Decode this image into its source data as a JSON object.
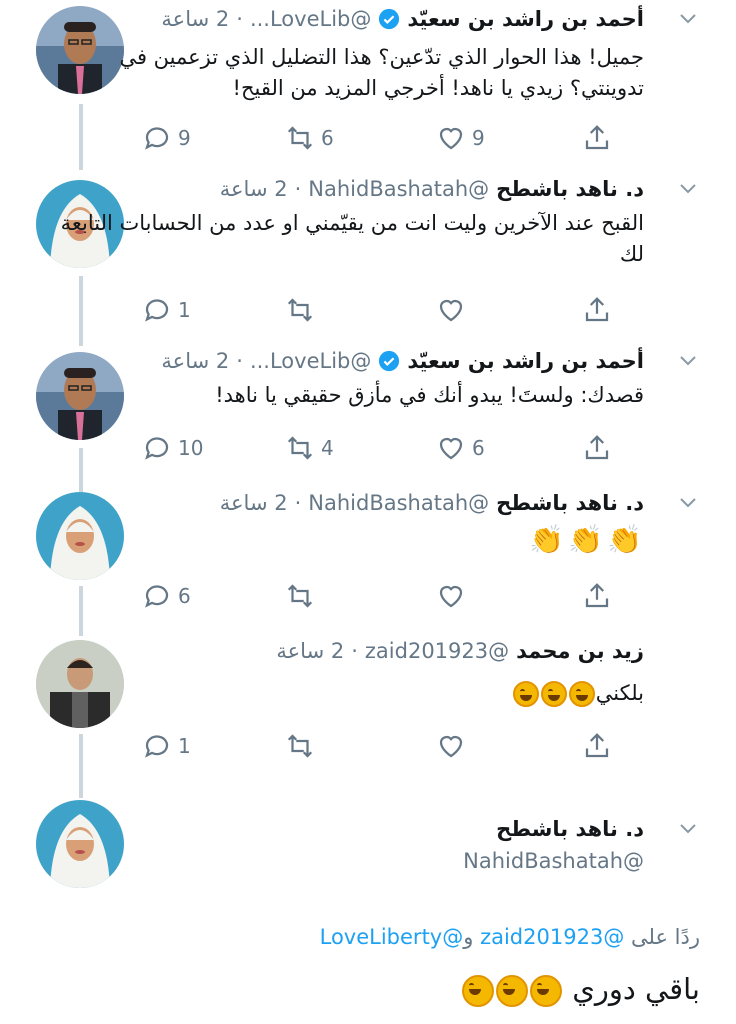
{
  "tweets": [
    {
      "name": "أحمد بن راشد بن سعيّد",
      "verified": true,
      "handle": "@LoveLib...",
      "time": "2 ساعة",
      "text": "جميل! هذا الحوار الذي تدّعين؟ هذا التضليل الذي تزعمين في تدوينتي؟ زيدي يا ناهد! أخرجي المزيد من القيح!",
      "replies": "9",
      "retweets": "6",
      "likes": "9"
    },
    {
      "name": "د. ناهد باشطح",
      "verified": false,
      "handle": "@NahidBashatah",
      "time": "2 ساعة",
      "text": "القبح عند الآخرين وليت انت من يقيّمني او عدد من الحسابات التابعة لك",
      "replies": "1",
      "retweets": "",
      "likes": ""
    },
    {
      "name": "أحمد بن راشد بن سعيّد",
      "verified": true,
      "handle": "@LoveLib...",
      "time": "2 ساعة",
      "text": "قصدك: ولستَ! يبدو أنك في مأزق حقيقي يا ناهد!",
      "replies": "10",
      "retweets": "4",
      "likes": "6"
    },
    {
      "name": "د. ناهد باشطح",
      "verified": false,
      "handle": "@NahidBashatah",
      "time": "2 ساعة",
      "text": "",
      "replies": "6",
      "retweets": "",
      "likes": ""
    },
    {
      "name": "زيد بن محمد",
      "verified": false,
      "handle": "@zaid201923",
      "time": "2 ساعة",
      "text": "بلكني",
      "replies": "1",
      "retweets": "",
      "likes": ""
    }
  ],
  "focused": {
    "name": "د. ناهد باشطح",
    "handle": "@NahidBashatah",
    "reply_label": "ردًا على",
    "reply_user1": "@zaid201923",
    "reply_and": "و",
    "reply_user2": "@LoveLiberty",
    "text": "باقي دوري"
  },
  "dot": "·",
  "colors": {
    "accent": "#1da1f2",
    "secondary": "#657786",
    "thread": "#ccd6dd"
  },
  "icons": [
    "reply-icon",
    "retweet-icon",
    "like-icon",
    "share-icon",
    "chevron-down-icon",
    "verified-badge-icon"
  ]
}
